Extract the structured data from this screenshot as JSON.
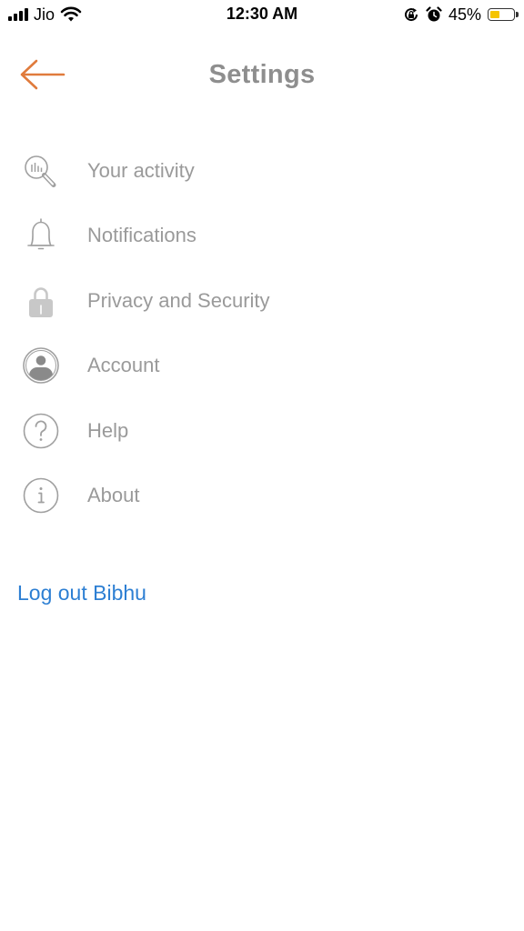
{
  "status_bar": {
    "carrier": "Jio",
    "time": "12:30 AM",
    "battery_percent": "45%",
    "battery_level": 0.45,
    "battery_color": "#f5c400"
  },
  "header": {
    "title": "Settings",
    "back_icon": "arrow-left-icon",
    "accent_color": "#e07b3c"
  },
  "menu": {
    "items": [
      {
        "label": "Your activity",
        "icon": "activity-search-icon"
      },
      {
        "label": "Notifications",
        "icon": "bell-icon"
      },
      {
        "label": "Privacy and Security",
        "icon": "lock-icon"
      },
      {
        "label": "Account",
        "icon": "account-icon"
      },
      {
        "label": "Help",
        "icon": "help-icon"
      },
      {
        "label": "About",
        "icon": "info-icon"
      }
    ]
  },
  "logout": {
    "label": "Log out Bibhu",
    "color": "#2d7fd3"
  }
}
